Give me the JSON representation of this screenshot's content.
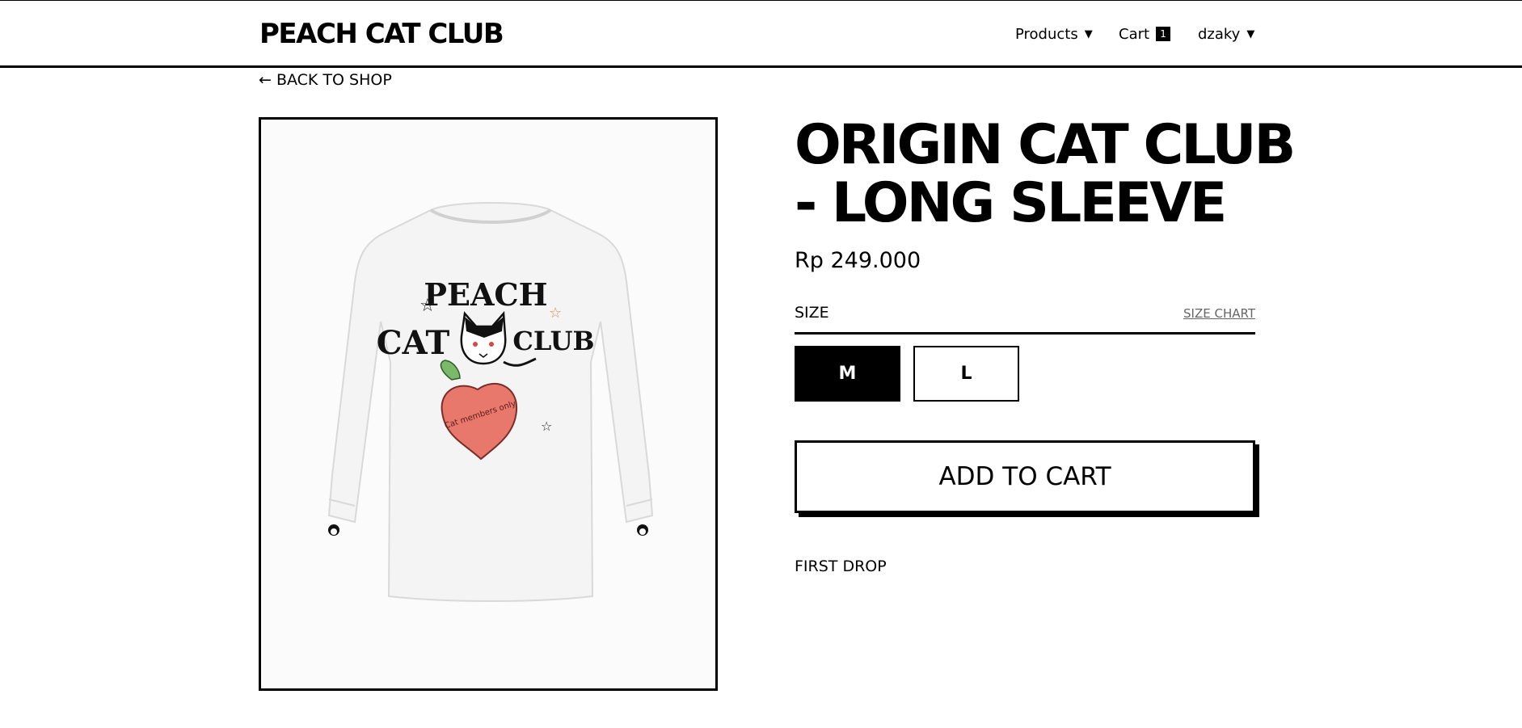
{
  "brand": "PEACH CAT CLUB",
  "nav": {
    "products_label": "Products",
    "cart_label": "Cart",
    "cart_count": "1",
    "user_label": "dzaky",
    "caret": "▼"
  },
  "back_link": "← BACK TO SHOP",
  "product": {
    "title_line1": "ORIGIN CAT CLUB",
    "title_line2": "- LONG SLEEVE",
    "price": "Rp 249.000",
    "size_label": "SIZE",
    "size_chart_label": "SIZE CHART",
    "sizes": [
      {
        "label": "M",
        "selected": true
      },
      {
        "label": "L",
        "selected": false
      }
    ],
    "add_to_cart_label": "ADD TO CART",
    "description": "FIRST DROP",
    "image_print": {
      "line1": "PEACH",
      "line2_left": "CAT",
      "line2_right": "CLUB",
      "heart_text": "Cat members only"
    }
  },
  "colors": {
    "accent": "#000000",
    "background": "#ffffff",
    "peach": "#e8786c"
  },
  "icons": [
    "caret-down-icon",
    "cat-logo-icon"
  ]
}
